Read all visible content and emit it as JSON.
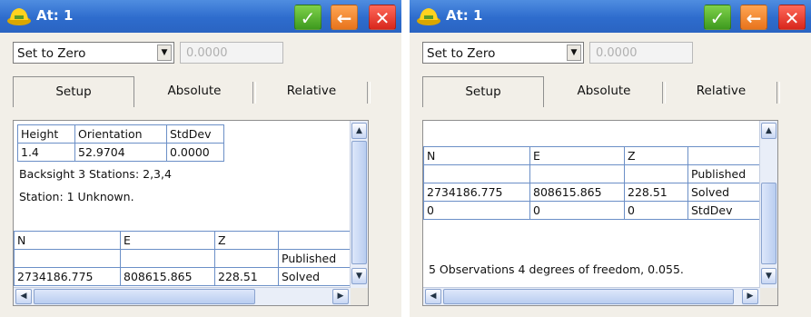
{
  "colors": {
    "titlebar": "#2e6ccd",
    "ok": "#3d9a1e",
    "back": "#e8741d",
    "close": "#d8261c",
    "grid": "#6b8fc7"
  },
  "left": {
    "title": "At: 1",
    "icons": {
      "app": "surveyor-hat-icon",
      "ok": "check-icon",
      "back": "arrow-left-icon",
      "close": "close-icon"
    },
    "ok_glyph": "✓",
    "back_glyph": "←",
    "close_glyph": "✕",
    "mode_select": "Set to Zero",
    "value_field": "0.0000",
    "tabs": [
      "Setup",
      "Absolute",
      "Relative"
    ],
    "setup_table": {
      "headers": [
        "Height",
        "Orientation",
        "StdDev"
      ],
      "row": [
        "1.4",
        "52.9704",
        "0.0000"
      ]
    },
    "backsight": "Backsight 3 Stations: 2,3,4",
    "station": "Station: 1 Unknown.",
    "coord_table": {
      "headers": [
        "N",
        "E",
        "Z",
        ""
      ],
      "rows": [
        [
          "",
          "",
          "",
          "Published"
        ],
        [
          "2734186.775",
          "808615.865",
          "228.51",
          "Solved"
        ]
      ]
    }
  },
  "right": {
    "title": "At: 1",
    "icons": {
      "app": "surveyor-hat-icon",
      "ok": "check-icon",
      "back": "arrow-left-icon",
      "close": "close-icon"
    },
    "ok_glyph": "✓",
    "back_glyph": "←",
    "close_glyph": "✕",
    "mode_select": "Set to Zero",
    "value_field": "0.0000",
    "tabs": [
      "Setup",
      "Absolute",
      "Relative"
    ],
    "coord_table": {
      "headers": [
        "N",
        "E",
        "Z",
        ""
      ],
      "rows": [
        [
          "",
          "",
          "",
          "Published"
        ],
        [
          "2734186.775",
          "808615.865",
          "228.51",
          "Solved"
        ],
        [
          "0",
          "0",
          "0",
          "StdDev"
        ]
      ]
    },
    "summary": "5 Observations 4 degrees of freedom, 0.055."
  }
}
